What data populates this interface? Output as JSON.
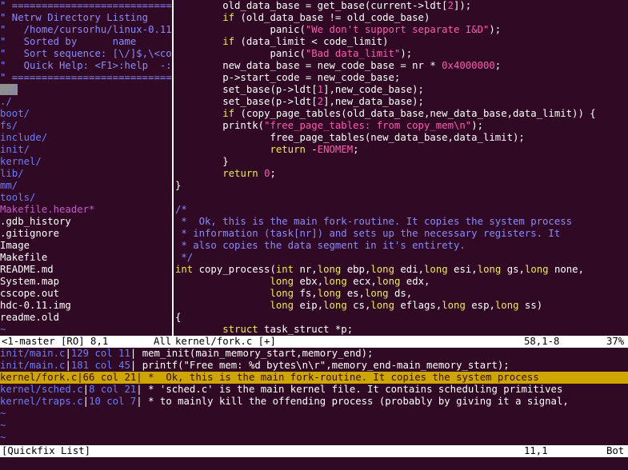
{
  "netrw": {
    "header": [
      "\" ============================================================================",
      "\" Netrw Directory Listing",
      "\"   /home/cursorhu/linux-0.11-",
      "\"   Sorted by      name",
      "\"   Sort sequence: [\\/]$,\\<cor",
      "\"   Quick Help: <F1>:help  -:g",
      "\" ============================================================================"
    ],
    "cursor_entry": "../",
    "dirs": [
      "./",
      "boot/",
      "fs/",
      "include/",
      "init/",
      "kernel/",
      "lib/",
      "mm/",
      "tools/"
    ],
    "header_file": "Makefile.header*",
    "files": [
      ".gdb_history",
      ".gitignore",
      "Image",
      "Makefile",
      "README.md",
      "System.map",
      "cscope.out",
      "hdc-0.11.img",
      "readme.old"
    ],
    "tilde": "~"
  },
  "code_lines": [
    [
      [
        "        old_data_base = get_base(current->ldt[",
        ""
      ],
      [
        "2",
        "num"
      ],
      [
        "]);",
        ""
      ]
    ],
    [
      [
        "        ",
        ""
      ],
      [
        "if",
        "kw"
      ],
      [
        " (old_data_base != old_code_base)",
        ""
      ]
    ],
    [
      [
        "                panic(",
        ""
      ],
      [
        "\"We don't support separate I&D\"",
        "str"
      ],
      [
        ");",
        ""
      ]
    ],
    [
      [
        "        ",
        ""
      ],
      [
        "if",
        "kw"
      ],
      [
        " (data_limit < code_limit)",
        ""
      ]
    ],
    [
      [
        "                panic(",
        ""
      ],
      [
        "\"Bad data_limit\"",
        "str"
      ],
      [
        ");",
        ""
      ]
    ],
    [
      [
        "        new_data_base = new_code_base = nr * ",
        ""
      ],
      [
        "0x4000000",
        "num"
      ],
      [
        ";",
        ""
      ]
    ],
    [
      [
        "        p->start_code = new_code_base;",
        ""
      ]
    ],
    [
      [
        "        set_base(p->ldt[",
        ""
      ],
      [
        "1",
        "num"
      ],
      [
        "],new_code_base);",
        ""
      ]
    ],
    [
      [
        "        set_base(p->ldt[",
        ""
      ],
      [
        "2",
        "num"
      ],
      [
        "],new_data_base);",
        ""
      ]
    ],
    [
      [
        "        ",
        ""
      ],
      [
        "if",
        "kw"
      ],
      [
        " (copy_page_tables(old_data_base,new_data_base,data_limit)) {",
        ""
      ]
    ],
    [
      [
        "        printk(",
        ""
      ],
      [
        "\"free_page_tables: from copy_mem\\n\"",
        "str"
      ],
      [
        ");",
        ""
      ]
    ],
    [
      [
        "                free_page_tables(new_data_base,data_limit);",
        ""
      ]
    ],
    [
      [
        "                ",
        ""
      ],
      [
        "return",
        "kw"
      ],
      [
        " -",
        ""
      ],
      [
        "ENOMEM",
        "str"
      ],
      [
        ";",
        ""
      ]
    ],
    [
      [
        "        }",
        ""
      ]
    ],
    [
      [
        "        ",
        ""
      ],
      [
        "return",
        "kw"
      ],
      [
        " ",
        ""
      ],
      [
        "0",
        "num"
      ],
      [
        ";",
        ""
      ]
    ],
    [
      [
        "}",
        ""
      ]
    ],
    [
      [
        "",
        ""
      ]
    ],
    [
      [
        "/*",
        "cmt"
      ]
    ],
    [
      [
        " *  Ok, this is the main fork-routine. It copies the system process",
        "cmt"
      ]
    ],
    [
      [
        " * information (task[nr]) and sets up the necessary registers. It",
        "cmt"
      ]
    ],
    [
      [
        " * also copies the data segment in it's entirety.",
        "cmt"
      ]
    ],
    [
      [
        " */",
        "cmt"
      ]
    ],
    [
      [
        "int",
        "kw"
      ],
      [
        " copy_process(",
        ""
      ],
      [
        "int",
        "kw"
      ],
      [
        " nr,",
        ""
      ],
      [
        "long",
        "kw"
      ],
      [
        " ebp,",
        ""
      ],
      [
        "long",
        "kw"
      ],
      [
        " edi,",
        ""
      ],
      [
        "long",
        "kw"
      ],
      [
        " esi,",
        ""
      ],
      [
        "long",
        "kw"
      ],
      [
        " gs,",
        ""
      ],
      [
        "long",
        "kw"
      ],
      [
        " none,",
        ""
      ]
    ],
    [
      [
        "                ",
        ""
      ],
      [
        "long",
        "kw"
      ],
      [
        " ebx,",
        ""
      ],
      [
        "long",
        "kw"
      ],
      [
        " ecx,",
        ""
      ],
      [
        "long",
        "kw"
      ],
      [
        " edx,",
        ""
      ]
    ],
    [
      [
        "                ",
        ""
      ],
      [
        "long",
        "kw"
      ],
      [
        " fs,",
        ""
      ],
      [
        "long",
        "kw"
      ],
      [
        " es,",
        ""
      ],
      [
        "long",
        "kw"
      ],
      [
        " ds,",
        ""
      ]
    ],
    [
      [
        "                ",
        ""
      ],
      [
        "long",
        "kw"
      ],
      [
        " eip,",
        ""
      ],
      [
        "long",
        "kw"
      ],
      [
        " cs,",
        ""
      ],
      [
        "long",
        "kw"
      ],
      [
        " eflags,",
        ""
      ],
      [
        "long",
        "kw"
      ],
      [
        " esp,",
        ""
      ],
      [
        "long",
        "kw"
      ],
      [
        " ss)",
        ""
      ]
    ],
    [
      [
        "{",
        ""
      ]
    ],
    [
      [
        "        ",
        ""
      ],
      [
        "struct",
        "kw"
      ],
      [
        " task_struct *p;",
        ""
      ]
    ]
  ],
  "status_main": {
    "left": "<1-master [RO] 8,1",
    "all": "All",
    "file": "kernel/fork.c [+]",
    "pos": "58,1-8",
    "pct": "37%"
  },
  "quickfix": [
    {
      "file": "init/main.c",
      "loc": "129 col 11",
      "text": " mem_init(main_memory_start,memory_end);"
    },
    {
      "file": "init/main.c",
      "loc": "181 col 45",
      "text": " printf(\"Free mem: %d bytes\\n\\r\",memory_end-main_memory_start);"
    },
    {
      "file": "kernel/fork.c",
      "loc": "66 col 21",
      "text": " *  Ok, this is the main fork-routine. It copies the system process"
    },
    {
      "file": "kernel/sched.c",
      "loc": "8 col 21",
      "text": " * 'sched.c' is the main kernel file. It contains scheduling primitives"
    },
    {
      "file": "kernel/traps.c",
      "loc": "10 col 7",
      "text": " * to mainly kill the offending process (probably by giving it a signal,"
    }
  ],
  "quickfix_selected": 2,
  "quickfix_tildes": [
    "~",
    "~",
    "~"
  ],
  "status_qf": {
    "name": "[Quickfix List]",
    "pos": "11,1",
    "pct": "Bot"
  },
  "cmdline": ""
}
